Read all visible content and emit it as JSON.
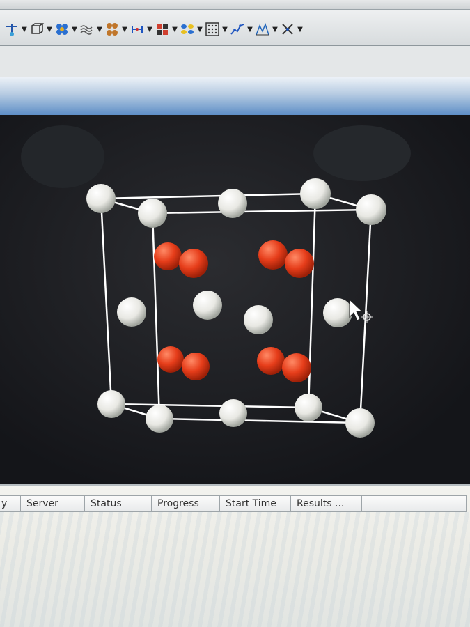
{
  "colors": {
    "atom_white": "#f2f2ee",
    "atom_red": "#e8401c",
    "viewer_background": "#1a1d24",
    "lattice_lines": "#ffffff",
    "title_gradient": "#4f84c2"
  },
  "toolbar": {
    "icons": [
      "atom-sketch-icon",
      "unit-cell-icon",
      "molecule-cluster-icon",
      "wave-surface-icon",
      "orbital-icon",
      "measure-icon",
      "crystal-builder-icon",
      "quad-orbital-icon",
      "lattice-grid-icon",
      "graph-plot-icon",
      "spectrum-icon",
      "symmetry-icon"
    ]
  },
  "structure": {
    "corner_atoms": 8,
    "face_center_atoms": 6,
    "interior_red_pairs": 4
  },
  "jobs_panel": {
    "columns": [
      "y",
      "Server",
      "Status",
      "Progress",
      "Start Time",
      "Results ..."
    ]
  }
}
